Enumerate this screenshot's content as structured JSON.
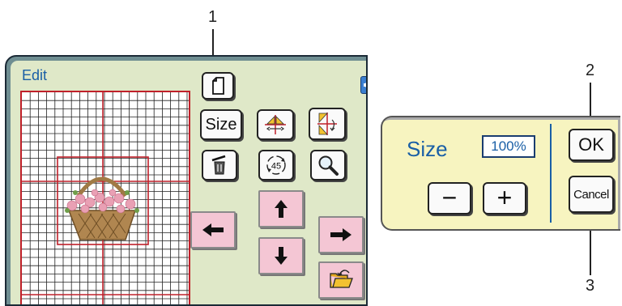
{
  "callouts": [
    "1",
    "2",
    "3"
  ],
  "edit_screen": {
    "title": "Edit",
    "buttons": {
      "size_label": "Size",
      "rotate_label": "45"
    },
    "icons": {
      "page": "page-outline-icon",
      "sound": "speaker-icon",
      "mirror": "mirror-flip-icon",
      "mirror_vertical": "vertical-flip-icon",
      "delete": "trash-icon",
      "rotate": "rotate-45-icon",
      "zoom": "magnifier-icon",
      "move_left": "arrow-left-icon",
      "move_up": "arrow-up-icon",
      "move_down": "arrow-down-icon",
      "move_right": "arrow-right-icon",
      "open": "open-folder-icon",
      "design": "flower-basket-image"
    }
  },
  "size_panel": {
    "label": "Size",
    "value": "100%",
    "minus": "−",
    "plus": "+",
    "ok": "OK",
    "cancel": "Cancel"
  },
  "colors": {
    "title_blue": "#1a5fa6",
    "grid_red": "#c0202a",
    "screen_bg": "#dfe8c8",
    "panel_bg": "#f7f4c0",
    "pink_button": "#f4c6d4"
  }
}
